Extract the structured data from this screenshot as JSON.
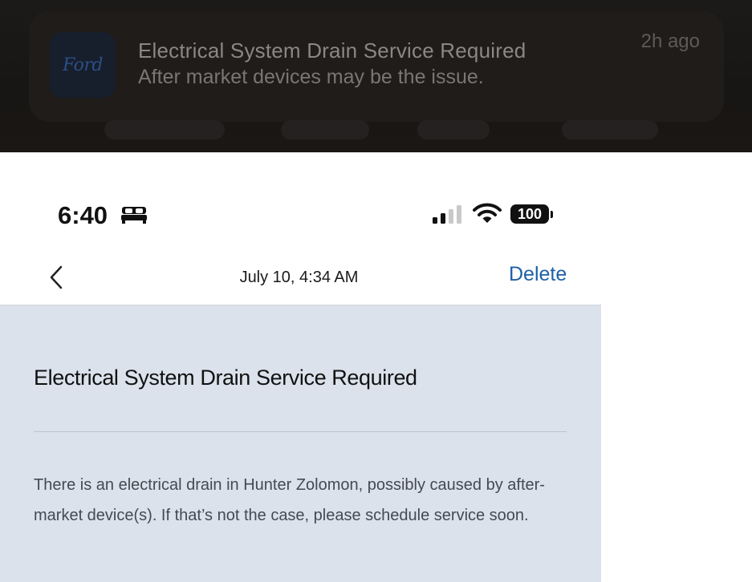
{
  "notification": {
    "app_icon": "ford-logo",
    "logo_text": "Ford",
    "title": "Electrical System Drain Service Required",
    "body": "After market devices may be the issue.",
    "time": "2h ago"
  },
  "status_bar": {
    "time": "6:40",
    "activity_icon": "bed-icon",
    "battery": "100"
  },
  "nav": {
    "date": "July 10, 4:34 AM",
    "delete_label": "Delete",
    "back_icon": "chevron-left-icon"
  },
  "message": {
    "title": "Electrical System Drain Service Required",
    "body": "There is an electrical drain in Hunter Zolomon, possibly caused by after-market device(s). If that’s not the case, please schedule service soon."
  },
  "colors": {
    "accent": "#1f5fa8",
    "content_background": "#dbe2ec",
    "banner_background": "#1c1a19"
  }
}
